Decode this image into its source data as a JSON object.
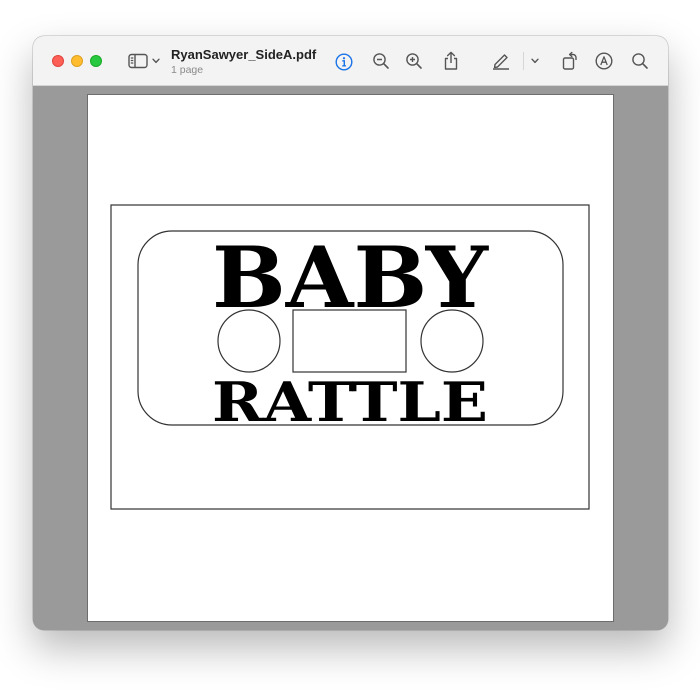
{
  "window": {
    "title": "RyanSawyer_SideA.pdf",
    "subtitle": "1 page"
  },
  "toolbar": {
    "icons": [
      "sidebar-icon",
      "chevron-down-icon",
      "info-icon",
      "zoom-out-icon",
      "zoom-in-icon",
      "share-icon",
      "markup-pen-icon",
      "chevron-down-icon",
      "rotate-icon",
      "annotate-icon",
      "search-icon"
    ],
    "accent_color": "#1a73e8"
  },
  "document": {
    "line_1": "BABY",
    "line_2": "RATTLE"
  }
}
